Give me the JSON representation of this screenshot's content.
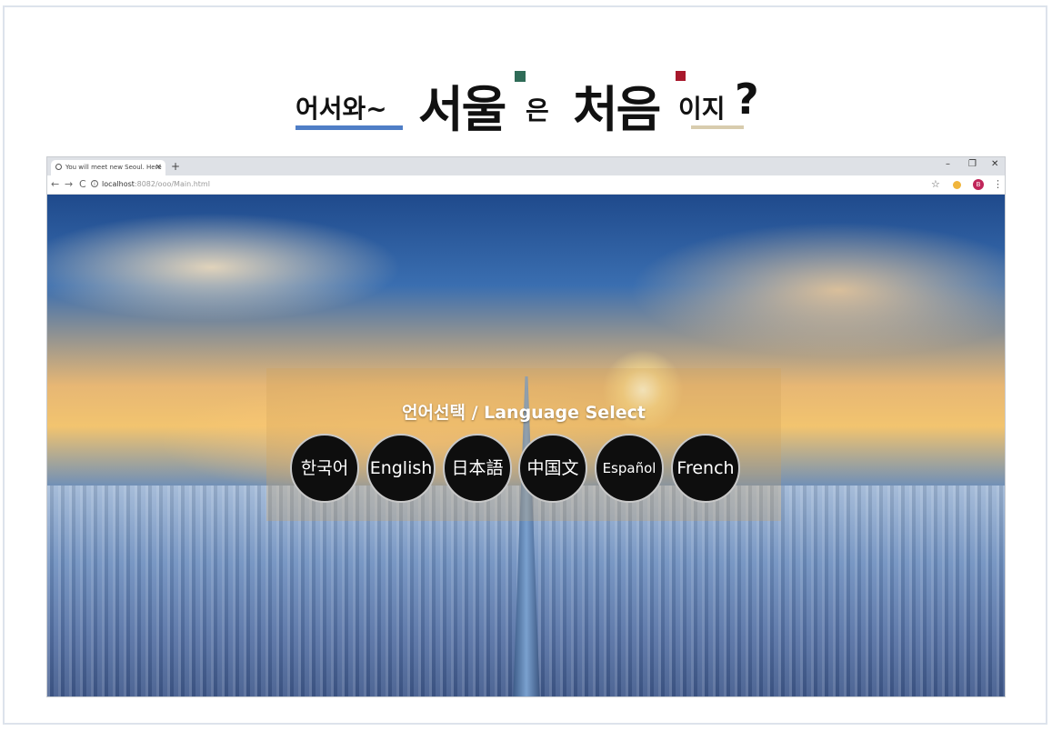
{
  "headline": {
    "part1": "어서와~",
    "part2": "서울",
    "part3": "은",
    "part4": "처음",
    "part5": "이지",
    "part6": "?"
  },
  "browser": {
    "tab_title": "You will meet new Seoul. Here",
    "tab_close": "×",
    "new_tab": "+",
    "win_minimize": "–",
    "win_restore": "❐",
    "win_close": "✕",
    "back": "←",
    "forward": "→",
    "reload": "C",
    "info": "i",
    "url_host": "localhost",
    "url_rest": ":8082/ooo/Main.html",
    "bookmark": "☆",
    "avatar_letter": "B",
    "menu": "⋮"
  },
  "panel": {
    "title": "언어선택 / Language Select",
    "languages": [
      "한국어",
      "English",
      "日本語",
      "中国文",
      "Español",
      "French"
    ]
  },
  "colors": {
    "underline_blue": "#4f7ec6",
    "underline_tan": "#d8ccae",
    "accent_green": "#2f6b57",
    "accent_red": "#a8182c",
    "button_bg": "#0e0e0e"
  }
}
